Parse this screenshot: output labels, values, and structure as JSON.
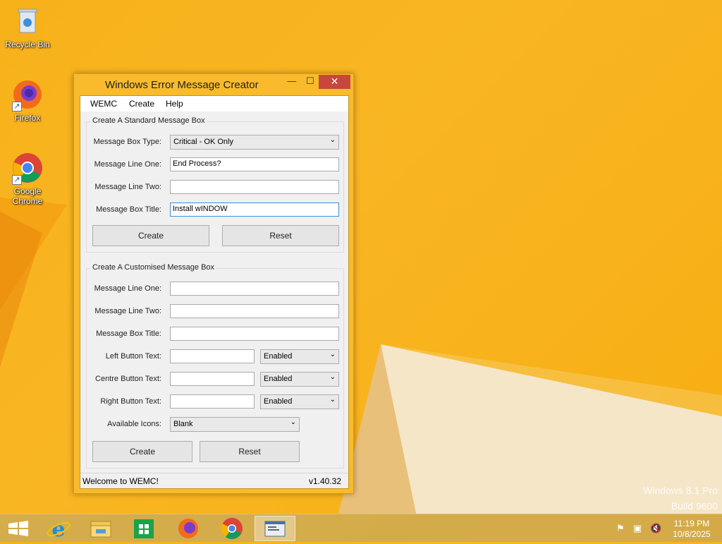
{
  "desktop": {
    "icons": [
      {
        "label": "Recycle Bin"
      },
      {
        "label": "Firefox"
      },
      {
        "label": "Google Chrome"
      }
    ],
    "watermark": {
      "line1": "Windows 8.1 Pro",
      "line2": "Build 9600"
    }
  },
  "window": {
    "title": "Windows Error Message Creator",
    "controls": {
      "minimize": "—",
      "maximize": "☐",
      "close": "✕"
    },
    "menu": [
      "WEMC",
      "Create",
      "Help"
    ],
    "standard": {
      "title": "Create A Standard Message Box",
      "type_label": "Message Box Type:",
      "type_value": "Critical - OK Only",
      "line1_label": "Message Line One:",
      "line1_value": "End Process?",
      "line2_label": "Message Line Two:",
      "line2_value": "",
      "title_label": "Message Box Title:",
      "title_value": "Install wINDOW",
      "create_button": "Create",
      "reset_button": "Reset"
    },
    "custom": {
      "title": "Create A Customised Message Box",
      "line1_label": "Message Line One:",
      "line1_value": "",
      "line2_label": "Message Line Two:",
      "line2_value": "",
      "title_label": "Message Box Title:",
      "title_value": "",
      "left_label": "Left Button Text:",
      "left_value": "",
      "left_state": "Enabled",
      "centre_label": "Centre Button Text:",
      "centre_value": "",
      "centre_state": "Enabled",
      "right_label": "Right Button Text:",
      "right_value": "",
      "right_state": "Enabled",
      "icons_label": "Available Icons:",
      "icons_value": "Blank",
      "create_button": "Create",
      "reset_button": "Reset"
    },
    "status": {
      "message": "Welcome to WEMC!",
      "version": "v1.40.32"
    }
  },
  "taskbar": {
    "clock_time": "11:19 PM",
    "clock_date": "10/8/2025",
    "apps": [
      "start",
      "internet-explorer",
      "file-explorer",
      "store",
      "firefox",
      "chrome",
      "wemc"
    ]
  },
  "colors": {
    "accent": "#f9bb2c",
    "close": "#c7473d",
    "desktop": "#f7b21a"
  }
}
